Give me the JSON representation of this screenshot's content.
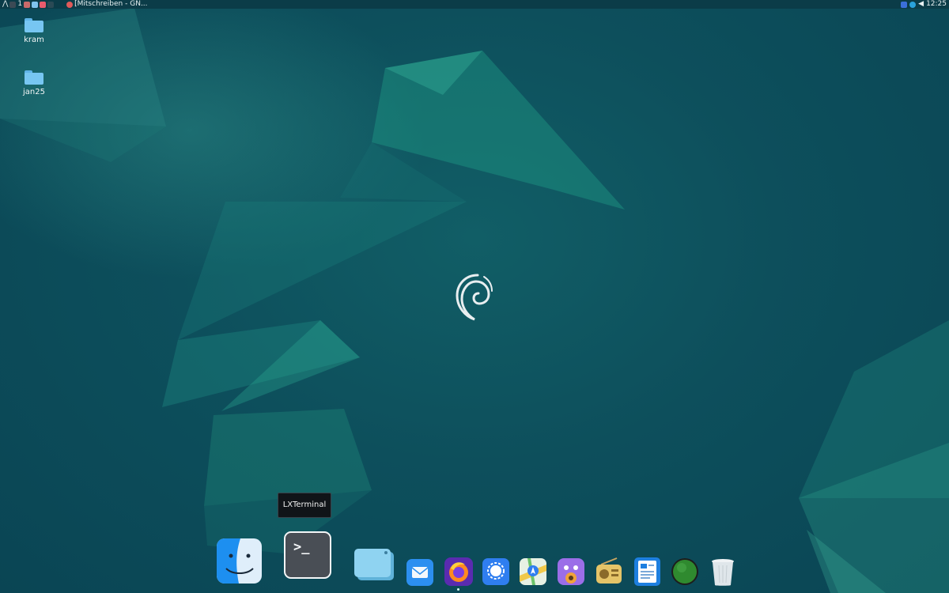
{
  "panel": {
    "workspace": "1",
    "taskbar_window_title": "[Mitschreiben - GN...",
    "clock": "12:25"
  },
  "desktop": {
    "icons": [
      {
        "label": "kram",
        "icon": "folder-icon"
      },
      {
        "label": "jan25",
        "icon": "folder-icon"
      }
    ]
  },
  "dock": {
    "tooltip": "LXTerminal",
    "items": [
      {
        "name": "finder",
        "icon": "finder-face-icon"
      },
      {
        "name": "lxterminal",
        "icon": "terminal-icon",
        "glyph": ">_"
      },
      {
        "name": "files",
        "icon": "file-manager-icon"
      },
      {
        "name": "mail",
        "icon": "mail-icon"
      },
      {
        "name": "firefox",
        "icon": "firefox-icon"
      },
      {
        "name": "signal",
        "icon": "signal-icon"
      },
      {
        "name": "maps",
        "icon": "maps-icon"
      },
      {
        "name": "podcast",
        "icon": "podcast-icon"
      },
      {
        "name": "radio",
        "icon": "radio-icon"
      },
      {
        "name": "text-editor",
        "icon": "document-icon"
      },
      {
        "name": "globe",
        "icon": "globe-icon"
      },
      {
        "name": "trash",
        "icon": "trash-icon"
      }
    ]
  },
  "colors": {
    "wallpaper": "#0d4f5c",
    "panel": "#0b3c48",
    "accent": "#1a8a7a"
  }
}
